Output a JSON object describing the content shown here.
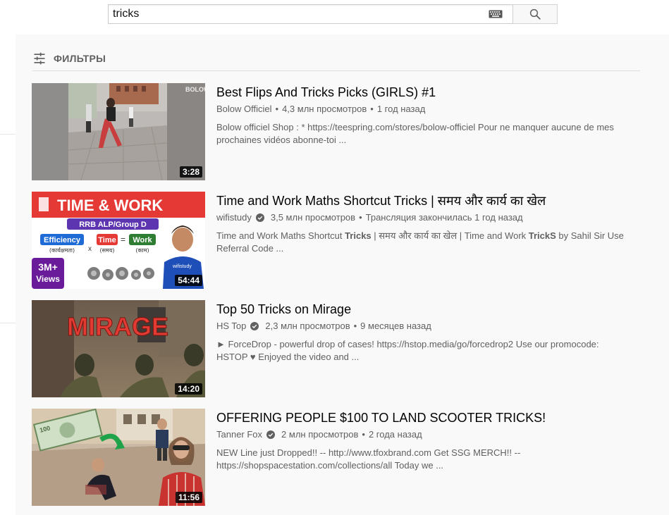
{
  "search": {
    "query": "tricks"
  },
  "filters": {
    "label": "ФИЛЬТРЫ"
  },
  "results": [
    {
      "title": "Best Flips And Tricks Picks (GIRLS) #1",
      "channel": "Bolow Officiel",
      "verified": false,
      "views": "4,3 млн просмотров",
      "age": "1 год назад",
      "description": "Bolow officiel Shop : * https://teespring.com/stores/bolow-officiel Pour ne manquer aucune de mes prochaines vidéos abonne-toi ...",
      "duration": "3:28"
    },
    {
      "title": "Time and Work Maths Shortcut Tricks | समय और कार्य का खेल",
      "channel": "wifistudy",
      "verified": true,
      "views": "3,5 млн просмотров",
      "age": "Трансляция закончилась 1 год назад",
      "description_parts": [
        "Time and Work Maths Shortcut ",
        "Tricks",
        " | समय और कार्य का खेल | Time and Work ",
        "TrickS",
        " by Sahil Sir Use Referral Code ..."
      ],
      "duration": "54:44",
      "thumb_text": {
        "headline": "TIME & WORK",
        "badge": "RRB ALP/Group D",
        "efficiency": "Efficiency",
        "efficiency_hi": "(कार्यक्षमता)",
        "times": "x",
        "time": "Time",
        "time_hi": "(समय)",
        "equals": "=",
        "work": "Work",
        "work_hi": "(काम)",
        "views_big": "3M+",
        "views_word": "Views",
        "logo": "wifistudy"
      }
    },
    {
      "title": "Top 50 Tricks on Mirage",
      "channel": "HS Top",
      "verified": true,
      "views": "2,3 млн просмотров",
      "age": "9 месяцев назад",
      "description": "► ForceDrop - powerful drop of cases! https://hstop.media/go/forcedrop2 Use our promocode: HSTOP ♥ Enjoyed the video and ...",
      "duration": "14:20",
      "thumb_text": {
        "headline": "MIRAGE"
      }
    },
    {
      "title": "OFFERING PEOPLE $100 TO LAND SCOOTER TRICKS!",
      "channel": "Tanner Fox",
      "verified": true,
      "views": "2 млн просмотров",
      "age": "2 года назад",
      "description": "NEW Line just Dropped!! -- http://www.tfoxbrand.com Get SSG MERCH!! -- https://shopspacestation.com/collections/all Today we ...",
      "duration": "11:56"
    }
  ],
  "icons": {
    "search": "search-icon",
    "keyboard": "keyboard-icon",
    "filter": "filter-icon",
    "verified": "verified-check-icon"
  }
}
